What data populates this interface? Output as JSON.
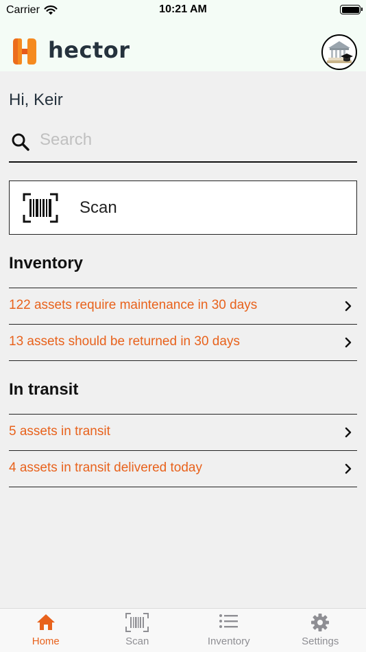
{
  "status_bar": {
    "carrier": "Carrier",
    "time": "10:21 AM"
  },
  "header": {
    "logo_text": "hector",
    "brand_color": "#f58a1f",
    "avatar_icon": "university-graduation-icon"
  },
  "greeting": "Hi, Keir",
  "search": {
    "placeholder": "Search",
    "value": ""
  },
  "scan_card": {
    "label": "Scan",
    "icon": "barcode-scan-icon"
  },
  "inventory": {
    "title": "Inventory",
    "items": [
      {
        "label": "122 assets require maintenance in 30 days"
      },
      {
        "label": "13 assets should be returned in 30 days"
      }
    ]
  },
  "in_transit": {
    "title": "In transit",
    "items": [
      {
        "label": "5 assets in transit"
      },
      {
        "label": "4 assets in transit delivered today"
      }
    ]
  },
  "tab_bar": {
    "active": "Home",
    "tabs": [
      {
        "label": "Home",
        "icon": "home-icon"
      },
      {
        "label": "Scan",
        "icon": "barcode-icon"
      },
      {
        "label": "Inventory",
        "icon": "list-icon"
      },
      {
        "label": "Settings",
        "icon": "gear-icon"
      }
    ]
  },
  "colors": {
    "accent": "#e8621c",
    "header_bg": "#f4fcf6",
    "page_bg": "#f0f0f0",
    "text_dark": "#25323d"
  }
}
